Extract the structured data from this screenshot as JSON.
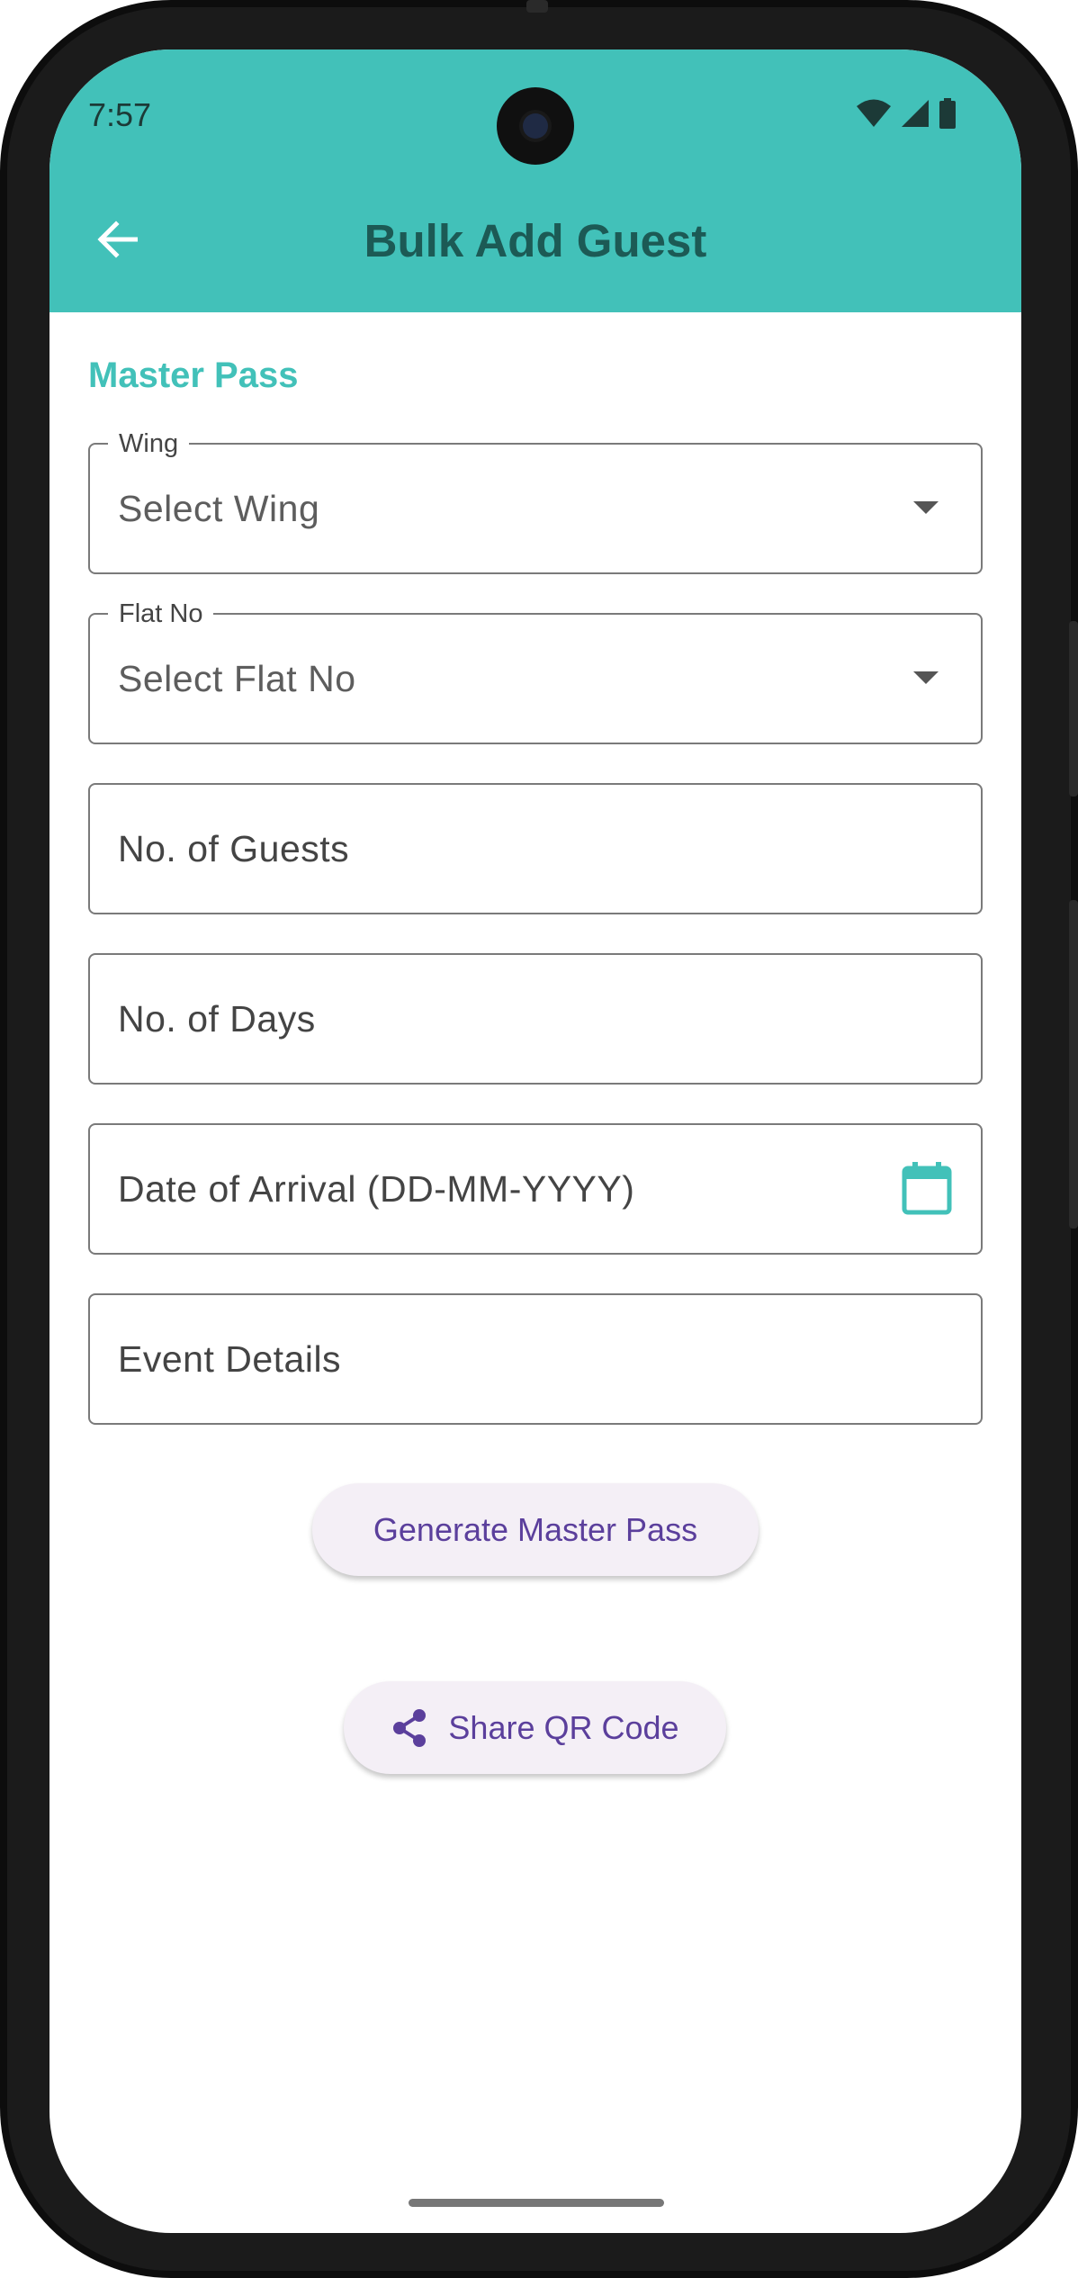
{
  "status_bar": {
    "time": "7:57",
    "icons": [
      "wifi-icon",
      "signal-icon",
      "battery-icon"
    ]
  },
  "app_bar": {
    "back_icon": "arrow-left-icon",
    "title": "Bulk Add Guest",
    "color": "#42c1b9",
    "title_color": "#1c5a55"
  },
  "form": {
    "section_title": "Master Pass",
    "wing": {
      "label": "Wing",
      "value": "Select Wing"
    },
    "flat": {
      "label": "Flat No",
      "value": "Select Flat No"
    },
    "guests": {
      "placeholder": "No. of Guests"
    },
    "days": {
      "placeholder": "No. of Days"
    },
    "arrival": {
      "placeholder": "Date of Arrival (DD-MM-YYYY)",
      "icon": "calendar-icon"
    },
    "event": {
      "placeholder": "Event Details"
    }
  },
  "actions": {
    "generate_label": "Generate Master Pass",
    "share_label": "Share QR Code",
    "share_icon": "share-icon",
    "button_text_color": "#5b3f9c"
  }
}
